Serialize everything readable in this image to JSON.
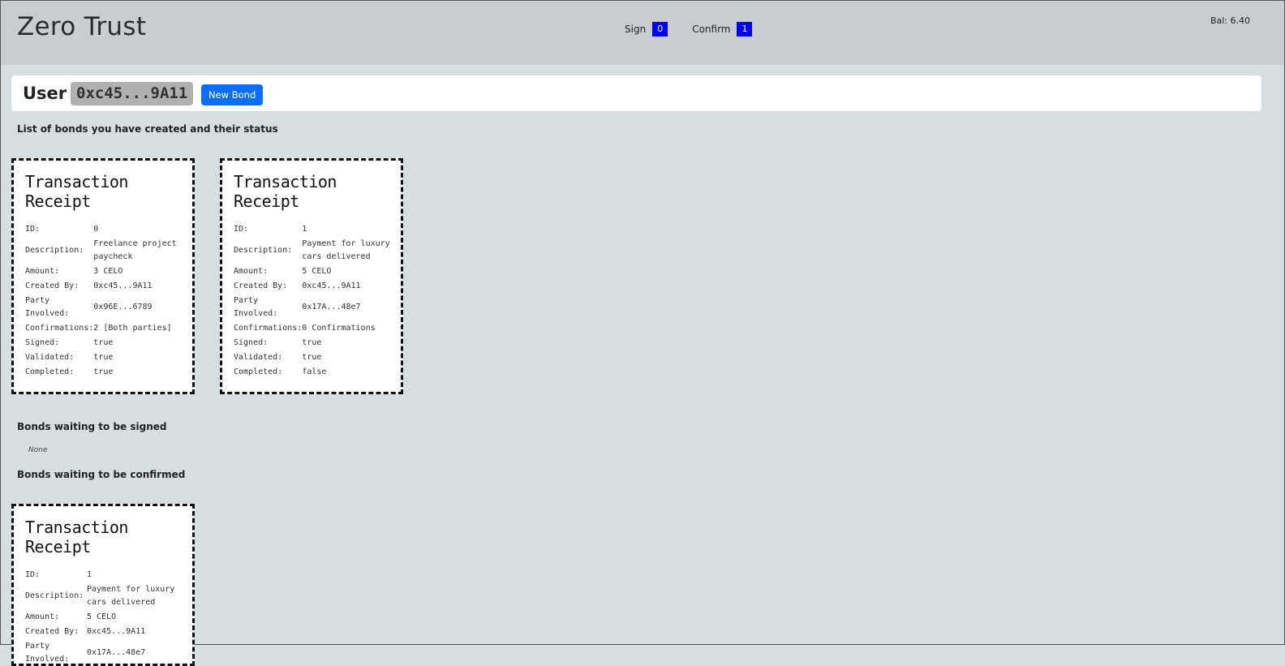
{
  "app": {
    "title": "Zero Trust",
    "balance": "Bal: 6.40"
  },
  "counters": {
    "sign": {
      "label": "Sign",
      "count": "0"
    },
    "confirm": {
      "label": "Confirm",
      "count": "1"
    }
  },
  "user": {
    "label": "User",
    "address": "0xc45...9A11",
    "new_bond_label": "New Bond"
  },
  "sections": {
    "created": "List of bonds you have created and their status",
    "to_sign": "Bonds waiting to be signed",
    "to_sign_empty": "None",
    "to_confirm": "Bonds waiting to be confirmed"
  },
  "field_labels": {
    "id": "ID:",
    "description": "Description:",
    "amount": "Amount:",
    "created_by": "Created By:",
    "party": "Party Involved:",
    "confirmations": "Confirmations:",
    "signed": "Signed:",
    "validated": "Validated:",
    "completed": "Completed:"
  },
  "receipt_title": "Transaction Receipt",
  "created_bonds": [
    {
      "id": "0",
      "description": "Freelance project paycheck",
      "amount": "3 CELO",
      "created_by": "0xc45...9A11",
      "party": "0x96E...6789",
      "confirmations": "2 [Both parties]",
      "signed": "true",
      "validated": "true",
      "completed": "true"
    },
    {
      "id": "1",
      "description": "Payment for luxury cars delivered",
      "amount": "5 CELO",
      "created_by": "0xc45...9A11",
      "party": "0x17A...48e7",
      "confirmations": "0 Confirmations",
      "signed": "true",
      "validated": "true",
      "completed": "false"
    }
  ],
  "confirm_bonds": [
    {
      "id": "1",
      "description": "Payment for luxury cars delivered",
      "amount": "5 CELO",
      "created_by": "0xc45...9A11",
      "party": "0x17A...48e7"
    }
  ]
}
